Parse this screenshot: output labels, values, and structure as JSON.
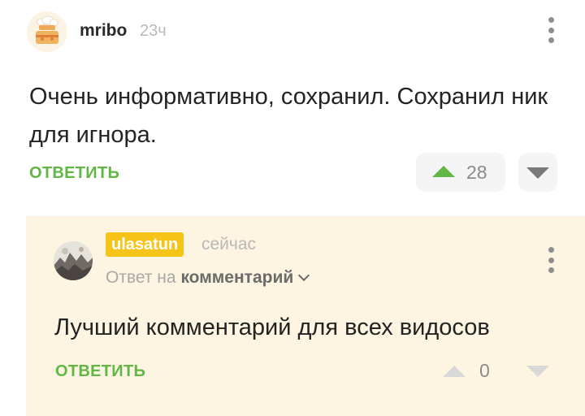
{
  "comment": {
    "author": "mribo",
    "time": "23ч",
    "text": "Очень информативно, сохранил. Сохранил ник для игнора.",
    "reply_label": "ОТВЕТИТЬ",
    "rating": "28",
    "avatar_icon": "chef-cake-avatar",
    "more_icon": "vertical-dots-icon",
    "upvote_icon": "triangle-up-icon",
    "downvote_icon": "triangle-down-icon"
  },
  "reply": {
    "author": "ulasatun",
    "time": "сейчас",
    "reply_to_prefix": "Ответ на",
    "reply_to_link": "комментарий",
    "text": "Лучший комментарий для всех видосов",
    "reply_label": "ОТВЕТИТЬ",
    "rating": "0",
    "avatar_icon": "photo-avatar"
  },
  "colors": {
    "accent_green": "#62b646",
    "author_badge": "#f6c318",
    "highlight_bg": "#fdf5e1"
  }
}
